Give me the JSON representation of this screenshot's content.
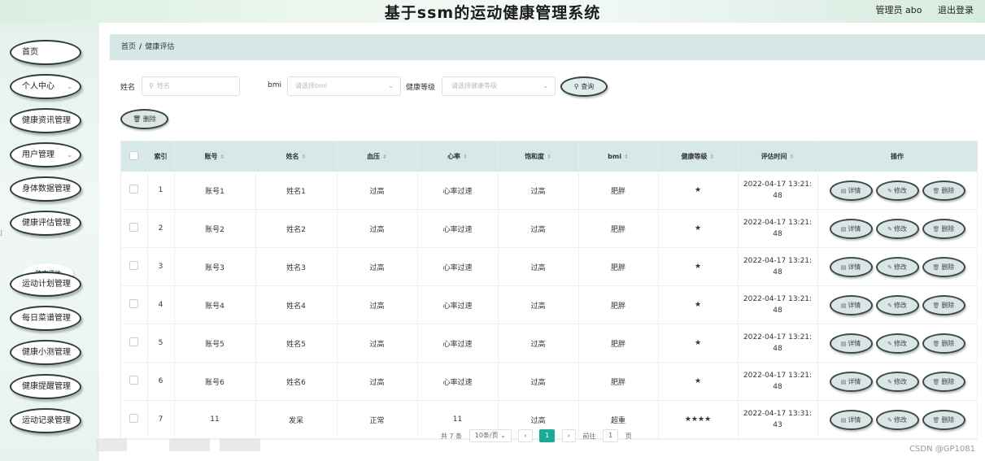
{
  "header": {
    "title": "基于ssm的运动健康管理系统",
    "user": "管理员 abo",
    "logout": "退出登录"
  },
  "sidebar": {
    "items": [
      {
        "label": "首页",
        "has_chevron": false
      },
      {
        "label": "个人中心",
        "has_chevron": true
      },
      {
        "label": "健康资讯管理",
        "has_chevron": false
      },
      {
        "label": "用户管理",
        "has_chevron": true
      },
      {
        "label": "身体数据管理",
        "has_chevron": false
      },
      {
        "label": "健康评估管理",
        "has_chevron": false
      },
      {
        "label": "运动计划管理",
        "has_chevron": false
      },
      {
        "label": "每日菜谱管理",
        "has_chevron": false
      },
      {
        "label": "健康小测管理",
        "has_chevron": false
      },
      {
        "label": "健康提醒管理",
        "has_chevron": false
      },
      {
        "label": "运动记录管理",
        "has_chevron": false
      }
    ],
    "subitem": "健康评估"
  },
  "breadcrumb": {
    "home": "首页",
    "separator": "/",
    "current": "健康评估"
  },
  "search": {
    "name_label": "姓名",
    "name_placeholder": "姓名",
    "bmi_label": "bmi",
    "bmi_placeholder": "请选择bmi",
    "level_label": "健康等级",
    "level_placeholder": "请选择健康等级",
    "query_button": "查询",
    "delete_button": "删除"
  },
  "table": {
    "headers": [
      "索引",
      "账号",
      "姓名",
      "血压",
      "心率",
      "饱和度",
      "bmi",
      "健康等级",
      "评估时间",
      "操作"
    ],
    "rows": [
      {
        "index": "1",
        "account": "账号1",
        "name": "姓名1",
        "bp": "过高",
        "hr": "心率过速",
        "sat": "过高",
        "bmi": "肥胖",
        "level": "★",
        "time": "2022-04-17 13:21:48"
      },
      {
        "index": "2",
        "account": "账号2",
        "name": "姓名2",
        "bp": "过高",
        "hr": "心率过速",
        "sat": "过高",
        "bmi": "肥胖",
        "level": "★",
        "time": "2022-04-17 13:21:48"
      },
      {
        "index": "3",
        "account": "账号3",
        "name": "姓名3",
        "bp": "过高",
        "hr": "心率过速",
        "sat": "过高",
        "bmi": "肥胖",
        "level": "★",
        "time": "2022-04-17 13:21:48"
      },
      {
        "index": "4",
        "account": "账号4",
        "name": "姓名4",
        "bp": "过高",
        "hr": "心率过速",
        "sat": "过高",
        "bmi": "肥胖",
        "level": "★",
        "time": "2022-04-17 13:21:48"
      },
      {
        "index": "5",
        "account": "账号5",
        "name": "姓名5",
        "bp": "过高",
        "hr": "心率过速",
        "sat": "过高",
        "bmi": "肥胖",
        "level": "★",
        "time": "2022-04-17 13:21:48"
      },
      {
        "index": "6",
        "account": "账号6",
        "name": "姓名6",
        "bp": "过高",
        "hr": "心率过速",
        "sat": "过高",
        "bmi": "肥胖",
        "level": "★",
        "time": "2022-04-17 13:21:48"
      },
      {
        "index": "7",
        "account": "11",
        "name": "发呆",
        "bp": "正常",
        "hr": "11",
        "sat": "过高",
        "bmi": "超重",
        "level": "★★★★",
        "time": "2022-04-17 13:31:43"
      }
    ],
    "actions": {
      "detail": "详情",
      "edit": "修改",
      "delete": "删除"
    }
  },
  "pager": {
    "total": "共 7 条",
    "page_size": "10条/页",
    "prev": "‹",
    "current": "1",
    "next": "›",
    "goto": "前往",
    "goto_value": "1",
    "page_unit": "页"
  },
  "watermark": "CSDN @GP1081",
  "icons": {
    "search": "search-icon",
    "delete": "trash-icon",
    "detail": "document-icon",
    "edit": "pencil-icon",
    "chevron": "chevron-down-icon"
  },
  "colors": {
    "accent": "#1aab95",
    "header_bg": "#d7e8e9"
  }
}
